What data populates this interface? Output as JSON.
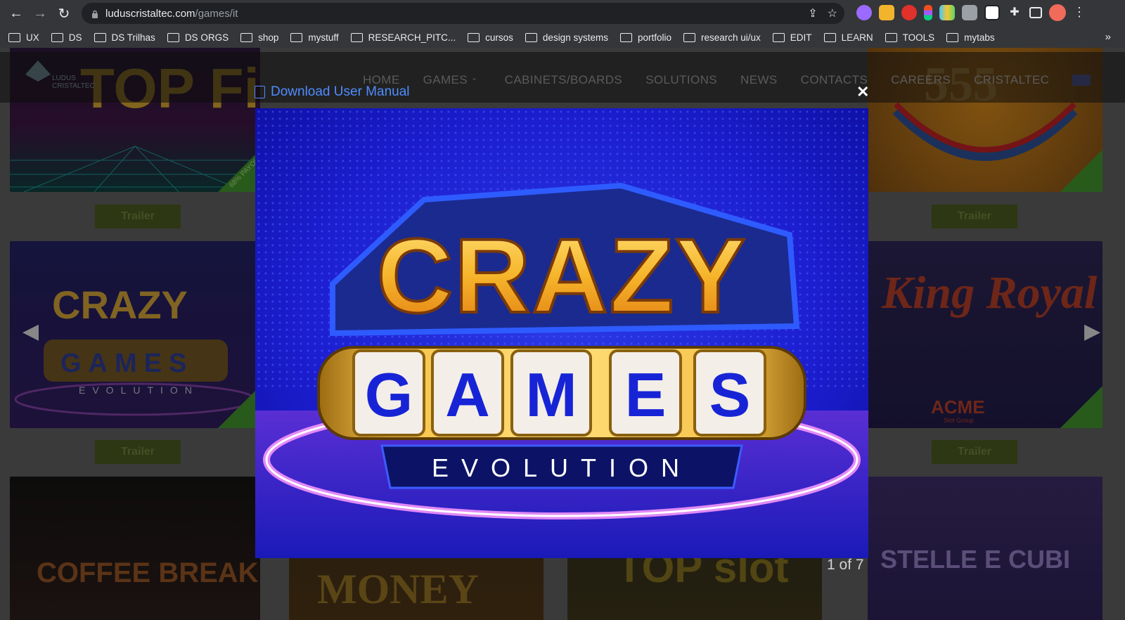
{
  "browser": {
    "url_host": "luduscristaltec.com",
    "url_path": "/games/it",
    "bookmarks": [
      "UX",
      "DS",
      "DS Trilhas",
      "DS ORGS",
      "shop",
      "mystuff",
      "RESEARCH_PITC...",
      "cursos",
      "design systems",
      "portfolio",
      "research ui/ux",
      "EDIT",
      "LEARN",
      "TOOLS",
      "mytabs"
    ],
    "more_label": "»"
  },
  "site": {
    "logo_text": "LUDUS CRISTALTEC",
    "menu": [
      "HOME",
      "GAMES",
      "CABINETS/BOARDS",
      "SOLUTIONS",
      "NEWS",
      "CONTACTS",
      "CAREERS",
      "CRISTALTEC"
    ],
    "trailer_label": "Trailer",
    "background_games": [
      "TOP Five",
      "555",
      "CRAZY GAMES EVOLUTION",
      "King Royal",
      "COFFEE BREAK",
      "MONEY",
      "TOP slot",
      "STELLE E CUBI"
    ],
    "payout_badge": "68% PAYOUT",
    "acme_text": "ACME",
    "acme_sub": "Slot Group"
  },
  "lightbox": {
    "download_label": "Download User Manual",
    "close_label": "✕",
    "counter": "1 of 7",
    "title_line1": "CRAZY",
    "reel_letters": [
      "G",
      "A",
      "M",
      "E",
      "S"
    ],
    "subtitle": "EVOLUTION"
  },
  "colors": {
    "link": "#4f8cff",
    "trailer_bg": "#46551f"
  }
}
